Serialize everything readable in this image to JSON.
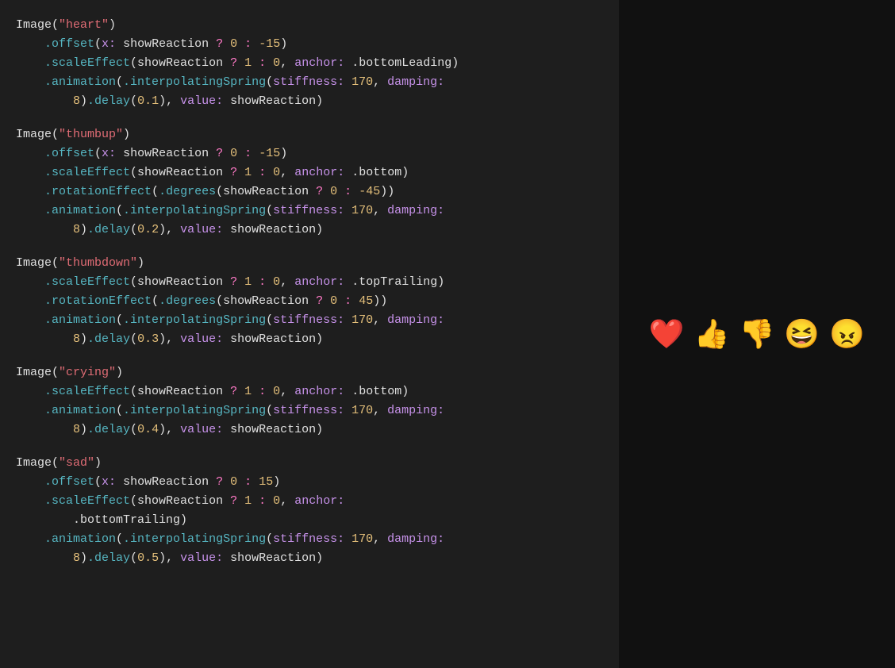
{
  "colors": {
    "background": "#1a1a1a",
    "code_bg": "#1e1e1e",
    "preview_bg": "#111111"
  },
  "emojis": [
    "❤️",
    "👍",
    "👎",
    "😆",
    "😠"
  ],
  "code_blocks": [
    {
      "id": "heart",
      "image_name": "heart",
      "lines": [
        {
          "indent": 0,
          "text": "Image(\"heart\")"
        },
        {
          "indent": 4,
          "text": ".offset(x: showReaction ? 0 : -15)"
        },
        {
          "indent": 4,
          "text": ".scaleEffect(showReaction ? 1 : 0, anchor: .bottomLeading)"
        },
        {
          "indent": 4,
          "text": ".animation(.interpolatingSpring(stiffness: 170, damping:"
        },
        {
          "indent": 8,
          "text": "8).delay(0.1), value: showReaction)"
        }
      ]
    },
    {
      "id": "thumbup",
      "image_name": "thumbup",
      "lines": [
        {
          "indent": 0,
          "text": "Image(\"thumbup\")"
        },
        {
          "indent": 4,
          "text": ".offset(x: showReaction ? 0 : -15)"
        },
        {
          "indent": 4,
          "text": ".scaleEffect(showReaction ? 1 : 0, anchor: .bottom)"
        },
        {
          "indent": 4,
          "text": ".rotationEffect(.degrees(showReaction ? 0 : -45))"
        },
        {
          "indent": 4,
          "text": ".animation(.interpolatingSpring(stiffness: 170, damping:"
        },
        {
          "indent": 8,
          "text": "8).delay(0.2), value: showReaction)"
        }
      ]
    },
    {
      "id": "thumbdown",
      "image_name": "thumbdown",
      "lines": [
        {
          "indent": 0,
          "text": "Image(\"thumbdown\")"
        },
        {
          "indent": 4,
          "text": ".scaleEffect(showReaction ? 1 : 0, anchor: .topTrailing)"
        },
        {
          "indent": 4,
          "text": ".rotationEffect(.degrees(showReaction ? 0 : 45))"
        },
        {
          "indent": 4,
          "text": ".animation(.interpolatingSpring(stiffness: 170, damping:"
        },
        {
          "indent": 8,
          "text": "8).delay(0.3), value: showReaction)"
        }
      ]
    },
    {
      "id": "crying",
      "image_name": "crying",
      "lines": [
        {
          "indent": 0,
          "text": "Image(\"crying\")"
        },
        {
          "indent": 4,
          "text": ".scaleEffect(showReaction ? 1 : 0, anchor: .bottom)"
        },
        {
          "indent": 4,
          "text": ".animation(.interpolatingSpring(stiffness: 170, damping:"
        },
        {
          "indent": 8,
          "text": "8).delay(0.4), value: showReaction)"
        }
      ]
    },
    {
      "id": "sad",
      "image_name": "sad",
      "lines": [
        {
          "indent": 0,
          "text": "Image(\"sad\")"
        },
        {
          "indent": 4,
          "text": ".offset(x: showReaction ? 0 : 15)"
        },
        {
          "indent": 4,
          "text": ".scaleEffect(showReaction ? 1 : 0, anchor:"
        },
        {
          "indent": 8,
          "text": ".bottomTrailing)"
        },
        {
          "indent": 4,
          "text": ".animation(.interpolatingSpring(stiffness: 170, damping:"
        },
        {
          "indent": 8,
          "text": "8).delay(0.5), value: showReaction)"
        }
      ]
    }
  ]
}
